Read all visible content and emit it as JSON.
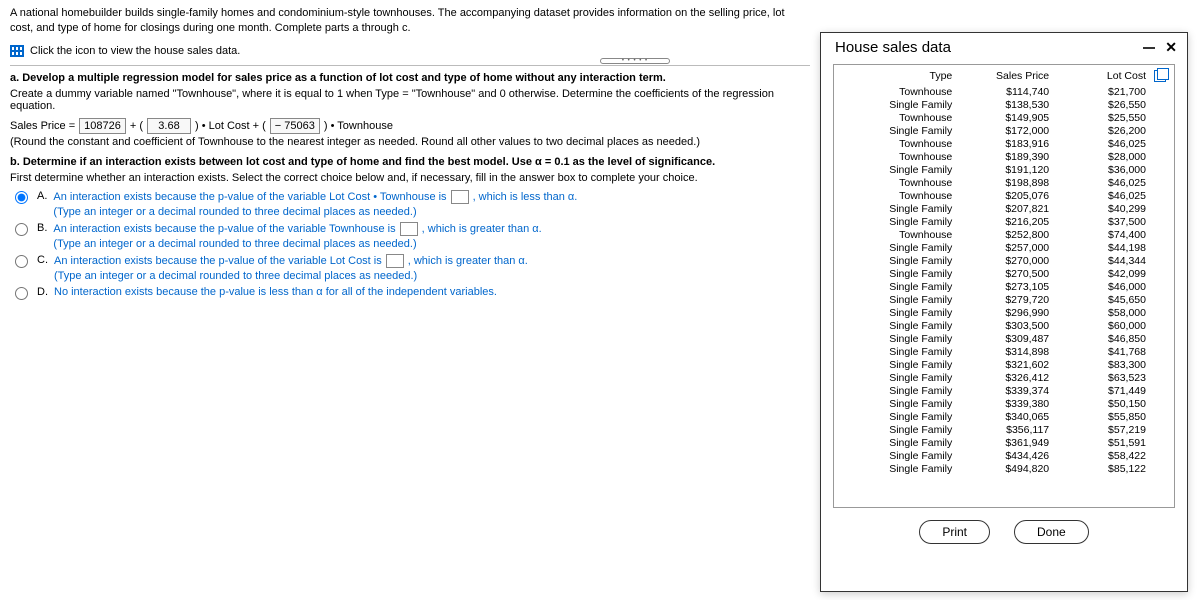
{
  "intro": "A national homebuilder builds single-family homes and condominium-style townhouses. The accompanying dataset provides information on the selling price, lot cost, and type of home for closings during one month. Complete parts a through c.",
  "data_link": "Click the icon to view the house sales data.",
  "part_a": {
    "heading": "a. Develop a multiple regression model for sales price as a function of lot cost and type of home without any interaction term.",
    "instruction": "Create a dummy variable named \"Townhouse\", where it is equal to 1 when Type = \"Townhouse\" and 0 otherwise. Determine the coefficients of the regression equation.",
    "eq_prefix": "Sales Price =",
    "const": "108726",
    "plus1": "+ (",
    "coef1": "3.68",
    "mid1": ") • Lot Cost + (",
    "coef2": "− 75063",
    "suffix": ") • Townhouse",
    "note": "(Round the constant and coefficient of Townhouse to the nearest integer as needed. Round all other values to two decimal places as needed.)"
  },
  "part_b": {
    "heading": "b. Determine if an interaction exists between lot cost and type of home and find the best model. Use α = 0.1 as the level of significance.",
    "sub": "First determine whether an interaction exists. Select the correct choice below and, if necessary, fill in the answer box to complete your choice.",
    "choices": {
      "A": {
        "label": "A.",
        "text1": "An interaction exists because the p-value of the variable Lot Cost • Townhouse is",
        "text2": ", which is less than α.",
        "hint": "(Type an integer or a decimal rounded to three decimal places as needed.)"
      },
      "B": {
        "label": "B.",
        "text1": "An interaction exists because the p-value of the variable Townhouse is",
        "text2": ", which is greater than α.",
        "hint": "(Type an integer or a decimal rounded to three decimal places as needed.)"
      },
      "C": {
        "label": "C.",
        "text1": "An interaction exists because the p-value of the variable Lot Cost is",
        "text2": ", which is greater than α.",
        "hint": "(Type an integer or a decimal rounded to three decimal places as needed.)"
      },
      "D": {
        "label": "D.",
        "text": "No interaction exists because the p-value is less than α for all of the independent variables."
      }
    }
  },
  "modal": {
    "title": "House sales data",
    "headers": {
      "type": "Type",
      "price": "Sales Price",
      "lot": "Lot Cost"
    },
    "rows": [
      {
        "type": "Townhouse",
        "price": "$114,740",
        "lot": "$21,700"
      },
      {
        "type": "Single Family",
        "price": "$138,530",
        "lot": "$26,550"
      },
      {
        "type": "Townhouse",
        "price": "$149,905",
        "lot": "$25,550"
      },
      {
        "type": "Single Family",
        "price": "$172,000",
        "lot": "$26,200"
      },
      {
        "type": "Townhouse",
        "price": "$183,916",
        "lot": "$46,025"
      },
      {
        "type": "Townhouse",
        "price": "$189,390",
        "lot": "$28,000"
      },
      {
        "type": "Single Family",
        "price": "$191,120",
        "lot": "$36,000"
      },
      {
        "type": "Townhouse",
        "price": "$198,898",
        "lot": "$46,025"
      },
      {
        "type": "Townhouse",
        "price": "$205,076",
        "lot": "$46,025"
      },
      {
        "type": "Single Family",
        "price": "$207,821",
        "lot": "$40,299"
      },
      {
        "type": "Single Family",
        "price": "$216,205",
        "lot": "$37,500"
      },
      {
        "type": "Townhouse",
        "price": "$252,800",
        "lot": "$74,400"
      },
      {
        "type": "Single Family",
        "price": "$257,000",
        "lot": "$44,198"
      },
      {
        "type": "Single Family",
        "price": "$270,000",
        "lot": "$44,344"
      },
      {
        "type": "Single Family",
        "price": "$270,500",
        "lot": "$42,099"
      },
      {
        "type": "Single Family",
        "price": "$273,105",
        "lot": "$46,000"
      },
      {
        "type": "Single Family",
        "price": "$279,720",
        "lot": "$45,650"
      },
      {
        "type": "Single Family",
        "price": "$296,990",
        "lot": "$58,000"
      },
      {
        "type": "Single Family",
        "price": "$303,500",
        "lot": "$60,000"
      },
      {
        "type": "Single Family",
        "price": "$309,487",
        "lot": "$46,850"
      },
      {
        "type": "Single Family",
        "price": "$314,898",
        "lot": "$41,768"
      },
      {
        "type": "Single Family",
        "price": "$321,602",
        "lot": "$83,300"
      },
      {
        "type": "Single Family",
        "price": "$326,412",
        "lot": "$63,523"
      },
      {
        "type": "Single Family",
        "price": "$339,374",
        "lot": "$71,449"
      },
      {
        "type": "Single Family",
        "price": "$339,380",
        "lot": "$50,150"
      },
      {
        "type": "Single Family",
        "price": "$340,065",
        "lot": "$55,850"
      },
      {
        "type": "Single Family",
        "price": "$356,117",
        "lot": "$57,219"
      },
      {
        "type": "Single Family",
        "price": "$361,949",
        "lot": "$51,591"
      },
      {
        "type": "Single Family",
        "price": "$434,426",
        "lot": "$58,422"
      },
      {
        "type": "Single Family",
        "price": "$494,820",
        "lot": "$85,122"
      }
    ],
    "buttons": {
      "print": "Print",
      "done": "Done"
    }
  }
}
